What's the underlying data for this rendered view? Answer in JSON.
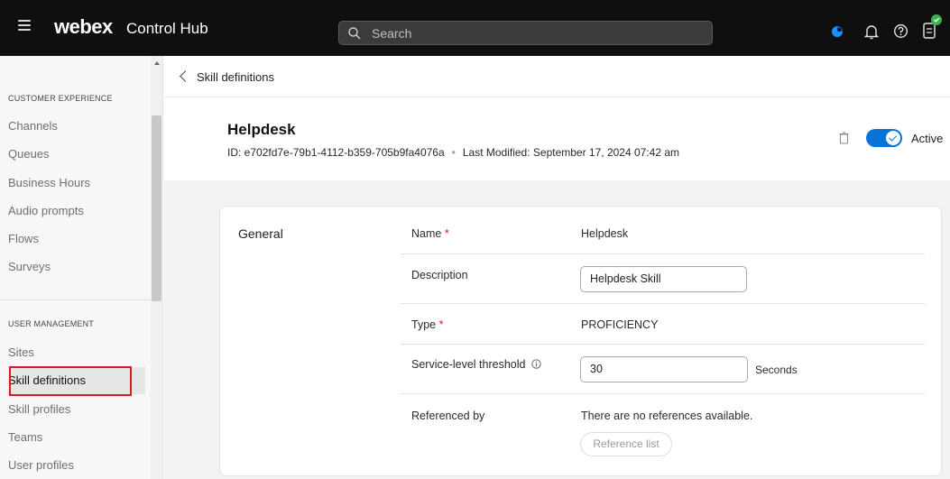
{
  "app": {
    "brand": "webex",
    "product": "Control Hub"
  },
  "search": {
    "placeholder": "Search"
  },
  "sidebar": {
    "sections": [
      {
        "heading": "CUSTOMER EXPERIENCE",
        "items": [
          "Channels",
          "Queues",
          "Business Hours",
          "Audio prompts",
          "Flows",
          "Surveys"
        ]
      },
      {
        "heading": "USER MANAGEMENT",
        "items": [
          "Sites",
          "Skill definitions",
          "Skill profiles",
          "Teams",
          "User profiles"
        ]
      }
    ],
    "active_item": "Skill definitions"
  },
  "breadcrumb": {
    "back_label": "Skill definitions"
  },
  "header": {
    "title": "Helpdesk",
    "id_text": "ID: e702fd7e-79b1-4112-b359-705b9fa4076a",
    "separator": "•",
    "modified_text": "Last Modified: September 17, 2024 07:42 am",
    "status_label": "Active",
    "status_on": true
  },
  "general": {
    "section_title": "General",
    "name_label": "Name",
    "name_value": "Helpdesk",
    "required_marker": "*",
    "description_label": "Description",
    "description_value": "Helpdesk Skill",
    "type_label": "Type",
    "type_value": "PROFICIENCY",
    "threshold_label": "Service-level threshold",
    "threshold_value": "30",
    "threshold_unit": "Seconds",
    "referenced_label": "Referenced by",
    "referenced_value": "There are no references available.",
    "reference_button": "Reference list"
  },
  "colors": {
    "topbar": "#0f0f0f",
    "accent": "#0a73d9",
    "highlight": "#d81b26",
    "status_ok": "#3fb24f"
  },
  "icons": {
    "top_right": [
      "webex-assistant-icon",
      "bell-icon",
      "help-icon",
      "user-status-icon"
    ]
  }
}
